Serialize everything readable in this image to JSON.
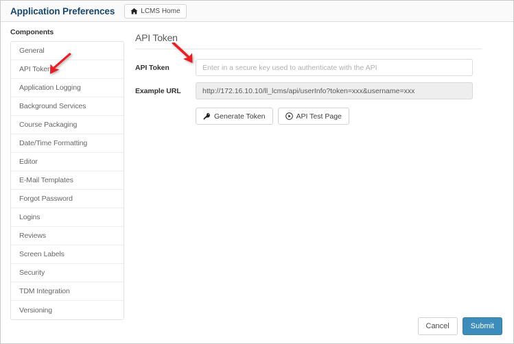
{
  "header": {
    "app_title": "Application Preferences",
    "home_button": {
      "label": "LCMS Home",
      "icon": "home-icon"
    }
  },
  "sidebar": {
    "heading": "Components",
    "items": [
      {
        "label": "General"
      },
      {
        "label": "API Token"
      },
      {
        "label": "Application Logging"
      },
      {
        "label": "Background Services"
      },
      {
        "label": "Course Packaging"
      },
      {
        "label": "Date/Time Formatting"
      },
      {
        "label": "Editor"
      },
      {
        "label": "E-Mail Templates"
      },
      {
        "label": "Forgot Password"
      },
      {
        "label": "Logins"
      },
      {
        "label": "Reviews"
      },
      {
        "label": "Screen Labels"
      },
      {
        "label": "Security"
      },
      {
        "label": "TDM Integration"
      },
      {
        "label": "Versioning"
      }
    ]
  },
  "main": {
    "section_title": "API Token",
    "fields": {
      "api_token": {
        "label": "API Token",
        "value": "",
        "placeholder": "Enter in a secure key used to authenticate with the API"
      },
      "example_url": {
        "label": "Example URL",
        "value": "http://172.16.10.10/ll_lcms/api/userInfo?token=xxx&username=xxx"
      }
    },
    "buttons": [
      {
        "label": "Generate Token",
        "icon": "key-icon"
      },
      {
        "label": "API Test Page",
        "icon": "play-circle-icon"
      }
    ]
  },
  "footer": {
    "cancel_label": "Cancel",
    "submit_label": "Submit"
  },
  "annotations": [
    {
      "name": "arrow-to-api-token-sidebar-item",
      "color": "#ec1c24",
      "direction": "down-left"
    },
    {
      "name": "arrow-to-api-token-field",
      "color": "#ec1c24",
      "direction": "down-right"
    }
  ],
  "colors": {
    "title_navy": "#17466f",
    "submit_blue": "#3c8dbc",
    "annotation_red": "#ec1c24",
    "readonly_gray": "#eeeeee"
  }
}
